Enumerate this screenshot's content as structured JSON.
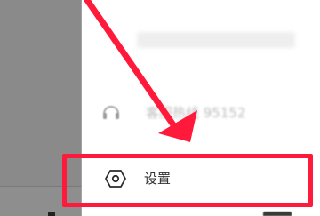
{
  "drawer": {
    "items": [
      {
        "label": "客服热线 95152",
        "icon": "headset-icon"
      }
    ],
    "settings": {
      "label": "设置",
      "icon": "hexagon-settings-icon"
    }
  },
  "annotation": {
    "color": "#ff1a3c"
  }
}
